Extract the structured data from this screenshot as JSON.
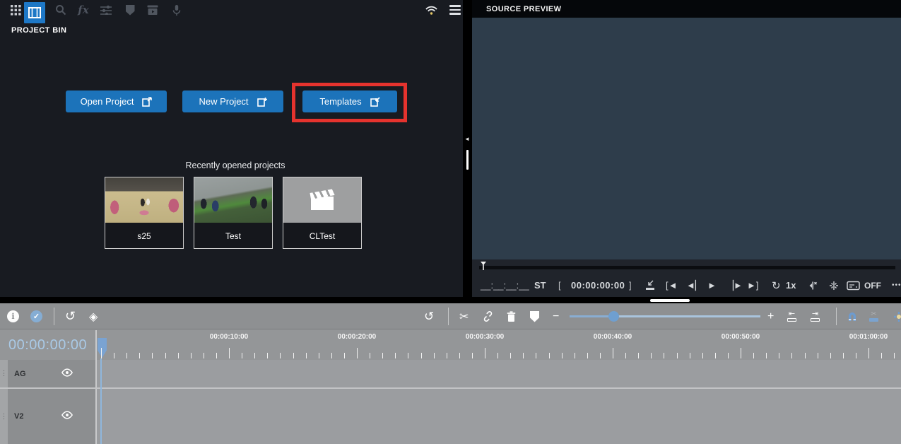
{
  "left_panel": {
    "title": "PROJECT BIN",
    "toolbar_icons": [
      "apps-grid",
      "project-bin",
      "search",
      "effects-fx",
      "adjust-sliders",
      "marker-shield",
      "media-export",
      "microphone"
    ],
    "status_icons": [
      "wifi",
      "menu"
    ],
    "buttons": [
      {
        "label": "Open Project"
      },
      {
        "label": "New Project"
      },
      {
        "label": "Templates",
        "highlighted": true
      }
    ],
    "recent_title": "Recently opened projects",
    "projects": [
      {
        "name": "s25"
      },
      {
        "name": "Test"
      },
      {
        "name": "CLTest"
      }
    ]
  },
  "source_preview": {
    "title": "SOURCE PREVIEW",
    "transport": {
      "source_timecode": "__:__:__:__",
      "st_label": "ST",
      "in_bracket": "[",
      "timecode": "00:00:00:00",
      "out_bracket": "]",
      "speed": "1x",
      "captions_state": "OFF"
    }
  },
  "timeline": {
    "current_timecode": "00:00:00:00",
    "ruler_labels": [
      "00:00:10:00",
      "00:00:20:00",
      "00:00:30:00",
      "00:00:40:00",
      "00:00:50:00",
      "00:01:00:00"
    ],
    "tracks": [
      {
        "name": "AG"
      },
      {
        "name": "V2"
      }
    ]
  },
  "icons_text": {
    "undo": "↺",
    "history": "↺",
    "layers": "◈",
    "cut": "✂",
    "razor": "✂",
    "minus": "−",
    "plus": "+",
    "check": "✓",
    "info": "i",
    "play": "►",
    "step_back": "◄▏",
    "step_fwd": "▕►",
    "goto_in": "[◄",
    "goto_out": "►]",
    "speed_loop": "↻",
    "more": "•••",
    "drag_dots": "⋮",
    "collapse": "◄",
    "fx": "fx",
    "shift_left": "⇤",
    "shift_right": "⇥"
  },
  "colors": {
    "accent_blue": "#1c73ba",
    "highlight_red": "#e5332e",
    "panel_dark": "#181b21",
    "preview_slate": "#2e3d4b",
    "timeline_gray": "#8f9193",
    "timecode_blue": "#a9c9e6"
  }
}
